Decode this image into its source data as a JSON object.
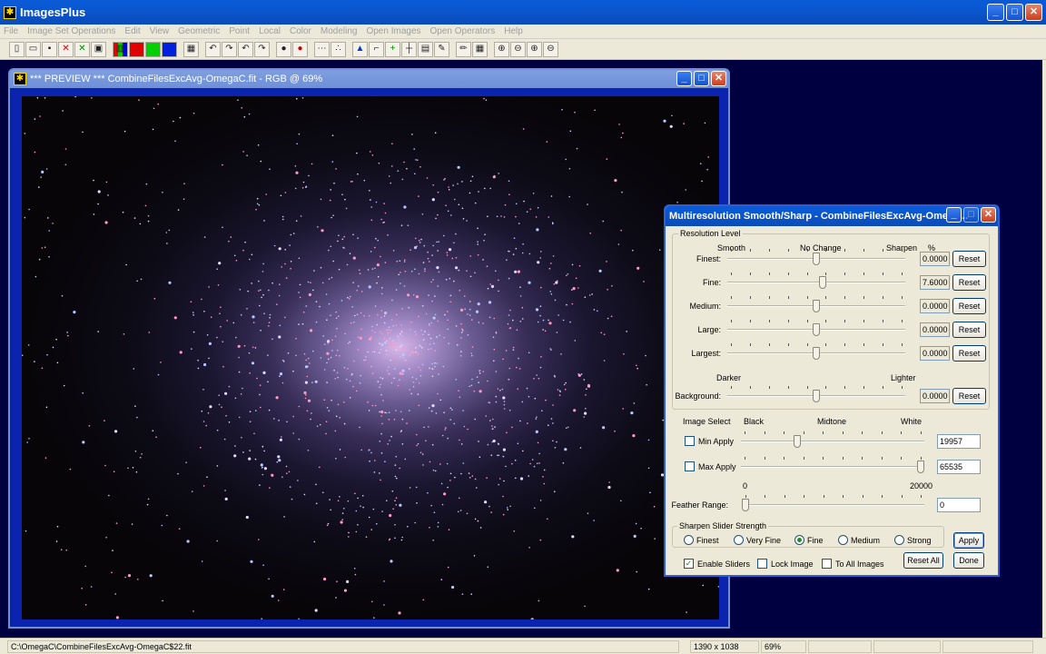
{
  "app": {
    "title": "ImagesPlus",
    "icon_glyph": "✱"
  },
  "menu": [
    "File",
    "Image Set Operations",
    "Edit",
    "View",
    "Geometric",
    "Point",
    "Local",
    "Color",
    "Modeling",
    "Open Images",
    "Open Operators",
    "Help"
  ],
  "toolbar": {
    "icons": [
      "new-icon",
      "open-icon",
      "save-icon",
      "close-x-icon",
      "close-all-icon",
      "copy-icon",
      "rgb-icon",
      "red-channel-icon",
      "green-channel-icon",
      "blue-channel-icon",
      "grid-icon",
      "undo-icon",
      "redo-icon",
      "undo-all-icon",
      "redo-all-icon",
      "dot-icon",
      "dot-red-icon",
      "dots-icon",
      "scatter-icon",
      "triangle-icon",
      "crop-icon",
      "plus-icon",
      "crosshair-icon",
      "frame-icon",
      "brush-icon",
      "pencil-icon",
      "table-icon",
      "zoom-in-icon",
      "zoom-out-icon",
      "zoom-fit-icon",
      "zoom-actual-icon"
    ]
  },
  "preview": {
    "title": "*** PREVIEW *** CombineFilesExcAvg-OmegaC.fit - RGB @ 69%"
  },
  "dialog": {
    "title": "Multiresolution Smooth/Sharp - CombineFilesExcAvg-Omega...",
    "resolution_group": "Resolution Level",
    "header_smooth": "Smooth",
    "header_nochange": "No Change",
    "header_sharpen": "Sharpen",
    "header_pct": "%",
    "levels": [
      {
        "label": "Finest:",
        "value": "0.0000",
        "reset": "Reset",
        "pos": 0.5
      },
      {
        "label": "Fine:",
        "value": "7.6000",
        "reset": "Reset",
        "pos": 0.538
      },
      {
        "label": "Medium:",
        "value": "0.0000",
        "reset": "Reset",
        "pos": 0.5
      },
      {
        "label": "Large:",
        "value": "0.0000",
        "reset": "Reset",
        "pos": 0.5
      },
      {
        "label": "Largest:",
        "value": "0.0000",
        "reset": "Reset",
        "pos": 0.5
      }
    ],
    "bg_darker": "Darker",
    "bg_lighter": "Lighter",
    "background": {
      "label": "Background:",
      "value": "0.0000",
      "reset": "Reset",
      "pos": 0.5
    },
    "image_select": "Image Select",
    "black": "Black",
    "midtone": "Midtone",
    "white": "White",
    "min_apply": {
      "label": "Min Apply",
      "value": "19957",
      "checked": false,
      "pos": 0.3
    },
    "max_apply": {
      "label": "Max Apply",
      "value": "65535",
      "checked": false,
      "pos": 1.0
    },
    "feather_min": "0",
    "feather_max": "20000",
    "feather": {
      "label": "Feather Range:",
      "value": "0",
      "pos": 0.0
    },
    "sharpen_group": "Sharpen Slider Strength",
    "strengths": [
      {
        "label": "Finest",
        "selected": false
      },
      {
        "label": "Very Fine",
        "selected": false
      },
      {
        "label": "Fine",
        "selected": true
      },
      {
        "label": "Medium",
        "selected": false
      },
      {
        "label": "Strong",
        "selected": false
      }
    ],
    "apply": "Apply",
    "enable_sliders": {
      "label": "Enable Sliders",
      "checked": true
    },
    "lock_image": {
      "label": "Lock Image",
      "checked": false
    },
    "to_all_images": {
      "label": "To All Images",
      "checked": false
    },
    "reset_all": "Reset All",
    "done": "Done"
  },
  "status": {
    "path": "C:\\OmegaC\\CombineFilesExcAvg-OmegaC$22.fit",
    "dimensions": "1390 x 1038",
    "zoom": "69%"
  }
}
